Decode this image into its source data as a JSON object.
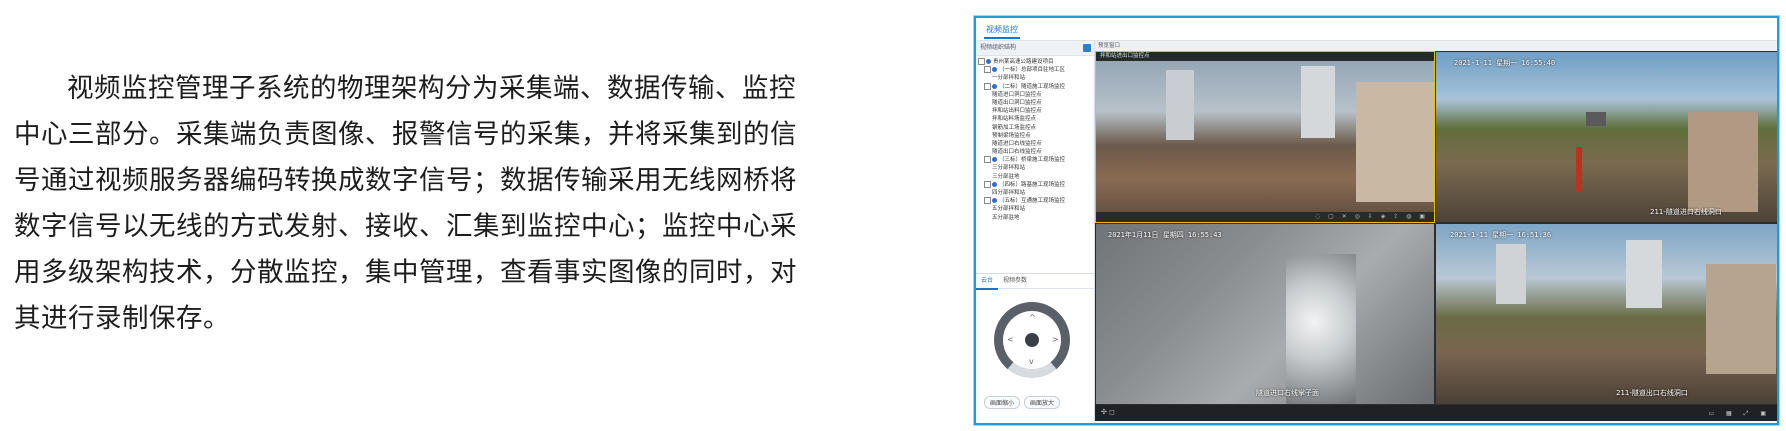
{
  "paragraph": "视频监控管理子系统的物理架构分为采集端、数据传输、监控中心三部分。采集端负责图像、报警信号的采集，并将采集到的信号通过视频服务器编码转换成数字信号；数据传输采用无线网桥将数字信号以无线的方式发射、接收、汇集到监控中心；监控中心采用多级架构技术，分散监控，集中管理，查看事实图像的同时，对其进行录制保存。",
  "app": {
    "tab_label": "视频监控",
    "left_header": "视频组织结构",
    "right_header": "预览窗口",
    "tree": [
      "贵州某高速公路建设项目",
      "（一标）总部项目驻地工区",
      "一分部拌和站",
      "（二标）隧道施工现场监控",
      "隧道进口洞口监控点",
      "隧道出口洞口监控点",
      "拌和站出料口监控点",
      "拌和站料场监控点",
      "钢筋加工场监控点",
      "预制梁场监控点",
      "隧道进口右线监控点",
      "隧道出口右线监控点",
      "（三标）桥梁施工现场监控",
      "三分部拌和站",
      "三分部驻地",
      "（四标）路基施工现场监控",
      "四分部拌和站",
      "（五标）互通施工现场监控",
      "五分部拌和站",
      "五分部驻地"
    ],
    "ptz_tabs": [
      "云台",
      "视频参数"
    ],
    "ptz_buttons": [
      "画面缩小",
      "画面放大"
    ],
    "cameras": [
      {
        "title": "拌和站进出口监控点",
        "timestamp": "",
        "caption": ""
      },
      {
        "timestamp": "2021-1-11  星期一  16:55:40",
        "caption": "211-隧道进口右线洞口"
      },
      {
        "timestamp": "2021年1月11日  星期四  16:55:43",
        "caption": "隧道进口右线掌子面"
      },
      {
        "timestamp": "2021-1-11  星期一  16:51:36",
        "caption": "211-隧道出口右线洞口"
      }
    ]
  },
  "colors": {
    "accent": "#1a76c8",
    "frame": "#1b9fd8"
  }
}
